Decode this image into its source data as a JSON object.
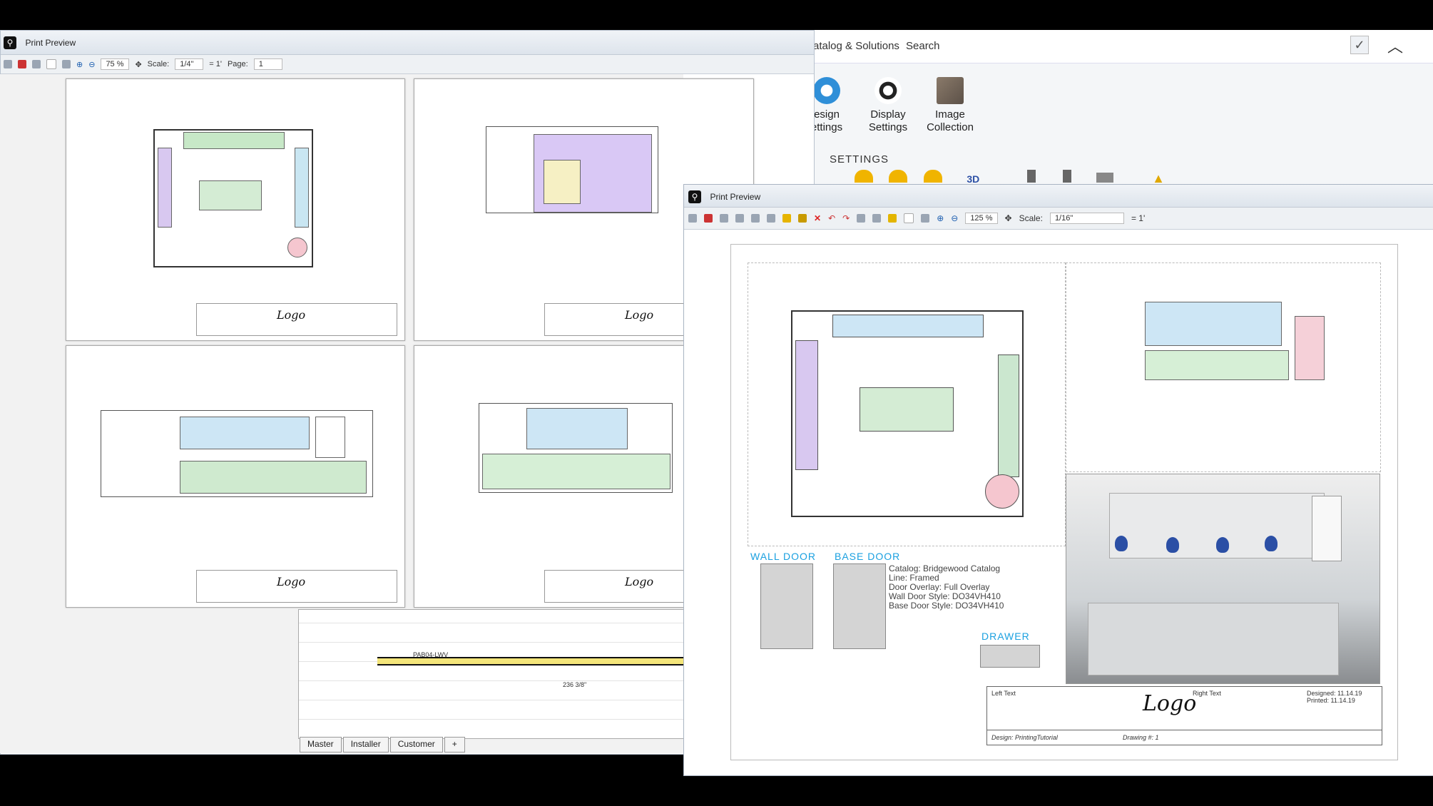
{
  "background_app": {
    "tabs": [
      "atalog & Solutions",
      "Search"
    ],
    "ribbon_buttons": [
      {
        "label": "esign\nettings",
        "icon": "gear-icon"
      },
      {
        "label": "Display\nSettings",
        "icon": "eye-icon"
      },
      {
        "label": "Image\nCollection",
        "icon": "image-collection-icon"
      }
    ],
    "group_label": "SETTINGS",
    "colors": {
      "accent": "#1aa0e0"
    }
  },
  "window1": {
    "title": "Print Preview",
    "zoom": "75 %",
    "scale_label": "Scale:",
    "scale_value": "1/4\"",
    "scale_unit": "= 1'",
    "page_label": "Page:",
    "page_value": "1",
    "sheet_tabs": [
      "Master",
      "Installer",
      "Customer",
      "+"
    ],
    "dims": [
      "236 3/8\"",
      "PAB04-LWV"
    ]
  },
  "window2": {
    "title": "Print Preview",
    "zoom": "125 %",
    "scale_label": "Scale:",
    "scale_value": "1/16\"",
    "scale_unit": "= 1'"
  },
  "sheet": {
    "wall_door_label": "WALL DOOR",
    "base_door_label": "BASE DOOR",
    "drawer_label": "DRAWER",
    "catalog_lines": [
      "Catalog: Bridgewood Catalog",
      "Line: Framed",
      "Door Overlay: Full Overlay",
      "Wall Door Style: DO34VH410",
      "Base Door Style: DO34VH410"
    ],
    "title_block": {
      "left_text": "Left Text",
      "right_text": "Right Text",
      "logo": "Logo",
      "designed": "Designed: 11.14.19",
      "printed": "Printed: 11.14.19",
      "design": "Design: PrintingTutorial",
      "drawing": "Drawing #: 1"
    }
  }
}
